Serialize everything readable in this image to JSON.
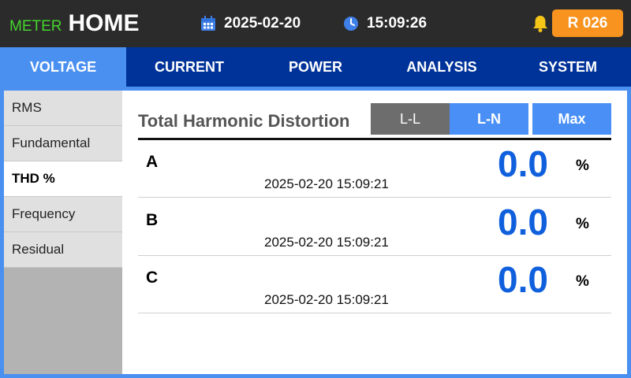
{
  "header": {
    "meter_label": "METER",
    "home_label": "HOME",
    "date": "2025-02-20",
    "time": "15:09:26",
    "alarm_badge": "R 026"
  },
  "tabs": [
    {
      "label": "VOLTAGE",
      "active": true
    },
    {
      "label": "CURRENT",
      "active": false
    },
    {
      "label": "POWER",
      "active": false
    },
    {
      "label": "ANALYSIS",
      "active": false
    },
    {
      "label": "SYSTEM",
      "active": false
    }
  ],
  "sidebar": {
    "items": [
      {
        "label": "RMS",
        "active": false
      },
      {
        "label": "Fundamental",
        "active": false
      },
      {
        "label": "THD %",
        "active": true
      },
      {
        "label": "Frequency",
        "active": false
      },
      {
        "label": "Residual",
        "active": false
      }
    ]
  },
  "panel": {
    "title": "Total Harmonic Distortion",
    "modes": {
      "ll": "L-L",
      "ln": "L-N",
      "max": "Max"
    },
    "selected_mode": "L-N",
    "rows": [
      {
        "name": "A",
        "timestamp": "2025-02-20 15:09:21",
        "value": "0.0",
        "unit": "%"
      },
      {
        "name": "B",
        "timestamp": "2025-02-20 15:09:21",
        "value": "0.0",
        "unit": "%"
      },
      {
        "name": "C",
        "timestamp": "2025-02-20 15:09:21",
        "value": "0.0",
        "unit": "%"
      }
    ]
  },
  "icons": {
    "date": "calendar-icon",
    "time": "clock-icon",
    "alarm": "bell-icon"
  },
  "colors": {
    "header_bg": "#2b2b2b",
    "meter_green": "#44d62c",
    "tab_bar": "#003399",
    "tab_active": "#4a90f0",
    "alarm_orange": "#f7931e",
    "value_blue": "#1060dd",
    "segment_blue": "#4a8ff5",
    "segment_gray": "#6d6d6d"
  }
}
